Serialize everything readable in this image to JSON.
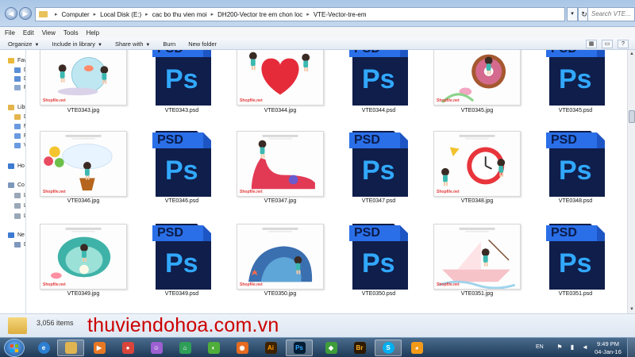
{
  "address": {
    "crumbs": [
      "Computer",
      "Local Disk (E:)",
      "cac bo thu vien moi",
      "DH200-Vector tre em chon loc",
      "VTE-Vector-tre-em"
    ],
    "search_placeholder": "Search VTE..."
  },
  "menu": [
    "File",
    "Edit",
    "View",
    "Tools",
    "Help"
  ],
  "commands": {
    "organize": "Organize",
    "include": "Include in library",
    "share": "Share with",
    "burn": "Burn",
    "new_folder": "New folder"
  },
  "nav": {
    "items": [
      {
        "label": "Fav",
        "icon": "star-icon",
        "color": "#e9b93b"
      },
      {
        "label": "D",
        "icon": "desktop-icon",
        "color": "#5b8fd6"
      },
      {
        "label": "D",
        "icon": "downloads-icon",
        "color": "#5b8fd6"
      },
      {
        "label": "R",
        "icon": "recent-places-icon",
        "color": "#8aa9d0"
      },
      {
        "label": "Libr",
        "icon": "libraries-icon",
        "color": "#e3b54c"
      },
      {
        "label": "D",
        "icon": "documents-icon",
        "color": "#e3b54c"
      },
      {
        "label": "M",
        "icon": "music-icon",
        "color": "#6a9be0"
      },
      {
        "label": "P",
        "icon": "pictures-icon",
        "color": "#6a9be0"
      },
      {
        "label": "V",
        "icon": "videos-icon",
        "color": "#6a9be0"
      },
      {
        "label": "Ho",
        "icon": "homegroup-icon",
        "color": "#3d7bd3"
      },
      {
        "label": "Co",
        "icon": "computer-icon",
        "color": "#7e98bc"
      },
      {
        "label": "L",
        "icon": "drive-icon",
        "color": "#9aa7b8"
      },
      {
        "label": "L",
        "icon": "drive-icon",
        "color": "#9aa7b8"
      },
      {
        "label": "L",
        "icon": "drive-icon",
        "color": "#9aa7b8"
      },
      {
        "label": "Ne",
        "icon": "network-icon",
        "color": "#3d7bd3"
      },
      {
        "label": "D",
        "icon": "network-pc-icon",
        "color": "#7e98bc"
      }
    ]
  },
  "files": [
    {
      "name": "VTE0343.jpg",
      "kind": "jpg",
      "art": "fishbowl"
    },
    {
      "name": "VTE0343.psd",
      "kind": "psd"
    },
    {
      "name": "VTE0344.jpg",
      "kind": "jpg",
      "art": "heart"
    },
    {
      "name": "VTE0344.psd",
      "kind": "psd"
    },
    {
      "name": "VTE0345.jpg",
      "kind": "jpg",
      "art": "donut"
    },
    {
      "name": "VTE0345.psd",
      "kind": "psd"
    },
    {
      "name": "VTE0346.jpg",
      "kind": "jpg",
      "art": "balloon"
    },
    {
      "name": "VTE0346.psd",
      "kind": "psd"
    },
    {
      "name": "VTE0347.jpg",
      "kind": "jpg",
      "art": "shoe"
    },
    {
      "name": "VTE0347.psd",
      "kind": "psd"
    },
    {
      "name": "VTE0348.jpg",
      "kind": "jpg",
      "art": "clock"
    },
    {
      "name": "VTE0348.psd",
      "kind": "psd"
    },
    {
      "name": "VTE0349.jpg",
      "kind": "jpg",
      "art": "shell"
    },
    {
      "name": "VTE0349.psd",
      "kind": "psd"
    },
    {
      "name": "VTE0350.jpg",
      "kind": "jpg",
      "art": "seashell"
    },
    {
      "name": "VTE0350.psd",
      "kind": "psd"
    },
    {
      "name": "VTE0351.jpg",
      "kind": "jpg",
      "art": "boat"
    },
    {
      "name": "VTE0351.psd",
      "kind": "psd"
    }
  ],
  "psd_icon": {
    "tab_label": "PSD",
    "logo": "Ps"
  },
  "thumb_credit": "Shopfile.net",
  "details": {
    "count": "3,056 items"
  },
  "watermark": "thuviendohoa.com.vn",
  "taskbar": {
    "apps": [
      {
        "name": "ie",
        "icon": "internet-explorer-icon",
        "glyph": "e",
        "bg": "#2d7fd2"
      },
      {
        "name": "explorer",
        "icon": "folder-icon",
        "glyph": "",
        "bg": "#e0b450",
        "active": true
      },
      {
        "name": "media",
        "icon": "media-player-icon",
        "glyph": "▶",
        "bg": "#e87722"
      },
      {
        "name": "chrome",
        "icon": "chrome-icon",
        "glyph": "●",
        "bg": "#d9453b"
      },
      {
        "name": "chat",
        "icon": "chat-app-icon",
        "glyph": "☺",
        "bg": "#9d5fd1"
      },
      {
        "name": "home",
        "icon": "home-app-icon",
        "glyph": "⌂",
        "bg": "#2f9e59"
      },
      {
        "name": "cc",
        "icon": "cc-cleaner-icon",
        "glyph": "◐",
        "bg": "#4fae3a"
      },
      {
        "name": "firefox",
        "icon": "firefox-icon",
        "glyph": "◉",
        "bg": "#e66a1f"
      },
      {
        "name": "ai",
        "icon": "illustrator-icon",
        "glyph": "Ai",
        "bg": "#3d2200",
        "fg": "#ff9a00"
      },
      {
        "name": "ps",
        "icon": "photoshop-icon",
        "glyph": "Ps",
        "bg": "#001d34",
        "fg": "#31a8ff",
        "active": true
      },
      {
        "name": "corel",
        "icon": "corel-icon",
        "glyph": "◆",
        "bg": "#3e9d3a"
      },
      {
        "name": "br",
        "icon": "bridge-icon",
        "glyph": "Br",
        "bg": "#2e1a00",
        "fg": "#ffb22b"
      },
      {
        "name": "skype",
        "icon": "skype-icon",
        "glyph": "S",
        "bg": "#00aff0",
        "active": true
      },
      {
        "name": "uc",
        "icon": "uc-browser-icon",
        "glyph": "◕",
        "bg": "#f39a18"
      }
    ],
    "lang": "EN",
    "time": "9:49 PM",
    "date": "04-Jan-16"
  },
  "colors": {
    "psd_dark": "#0f1e4a",
    "psd_light": "#2a6fe8",
    "thumb_credit": "#e23b3b"
  }
}
